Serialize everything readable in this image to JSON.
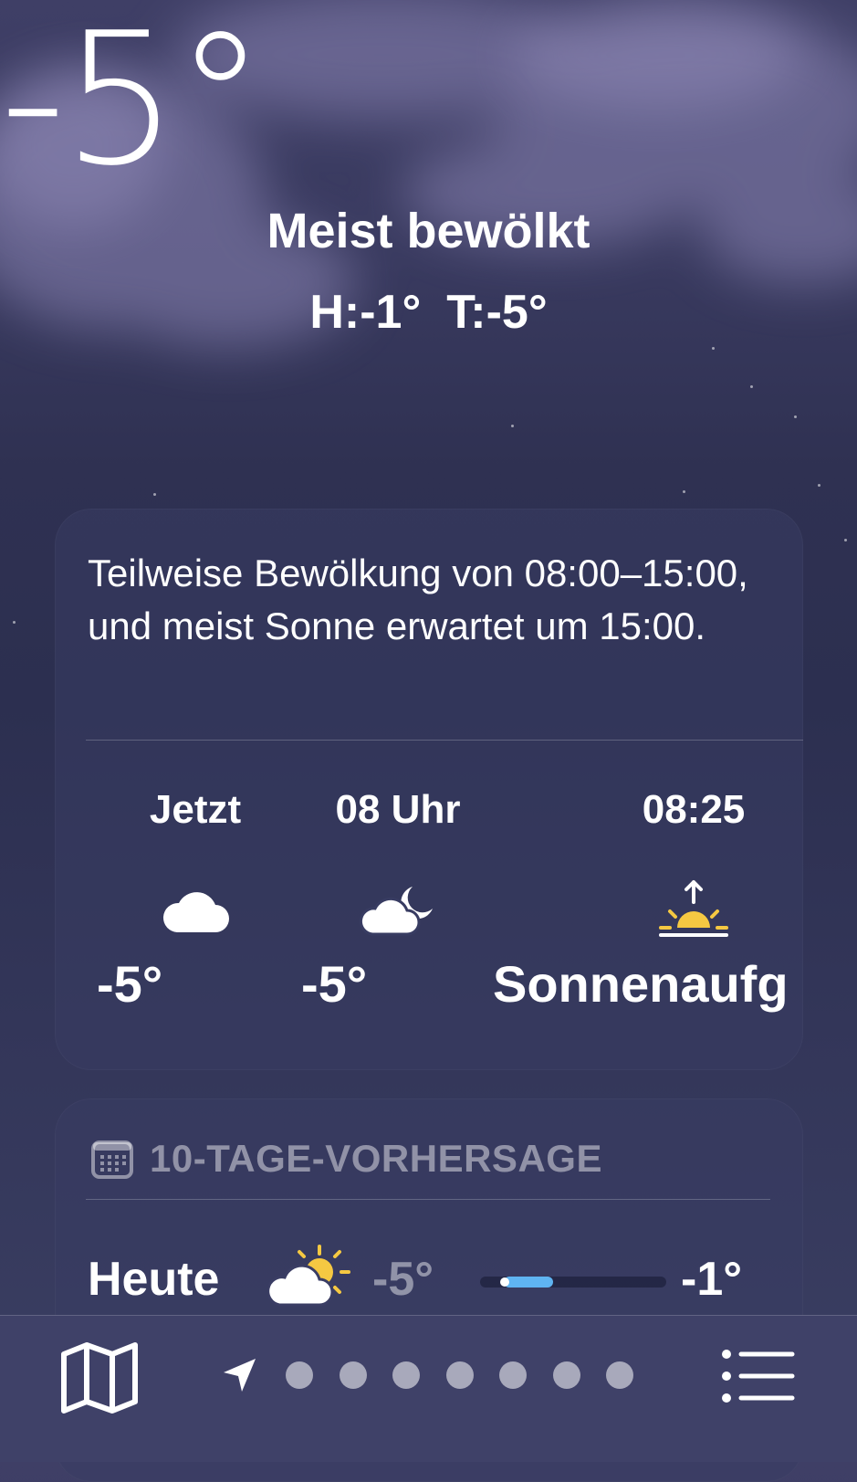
{
  "current": {
    "temperature": "-5°",
    "condition": "Meist bewölkt",
    "high": "H:-1°",
    "low": "T:-5°"
  },
  "hourly_card": {
    "summary": "Teilweise Bewölkung von 08:00–15:00, und meist Sonne erwartet um 15:00.",
    "hours": [
      {
        "time": "Jetzt",
        "icon": "cloud-icon",
        "value": "-5°"
      },
      {
        "time": "08 Uhr",
        "icon": "cloud-moon-icon",
        "value": "-5°"
      },
      {
        "time": "08:25",
        "icon": "sunrise-icon",
        "value": "Sonnenaufg"
      }
    ]
  },
  "forecast_card": {
    "header": "10-TAGE-VORHERSAGE",
    "header_icon": "calendar-icon",
    "rows": [
      {
        "day": "Heute",
        "icon": "partly-sunny-icon",
        "low": "-5°",
        "high": "-1°"
      }
    ]
  },
  "bottom_bar": {
    "map_icon": "map-icon",
    "location_icon": "location-arrow-icon",
    "page_count": 7,
    "list_icon": "list-icon"
  },
  "colors": {
    "range_bar": "#5fb4f2",
    "sun": "#f5c842",
    "bottom_bar": "#3f4168"
  }
}
